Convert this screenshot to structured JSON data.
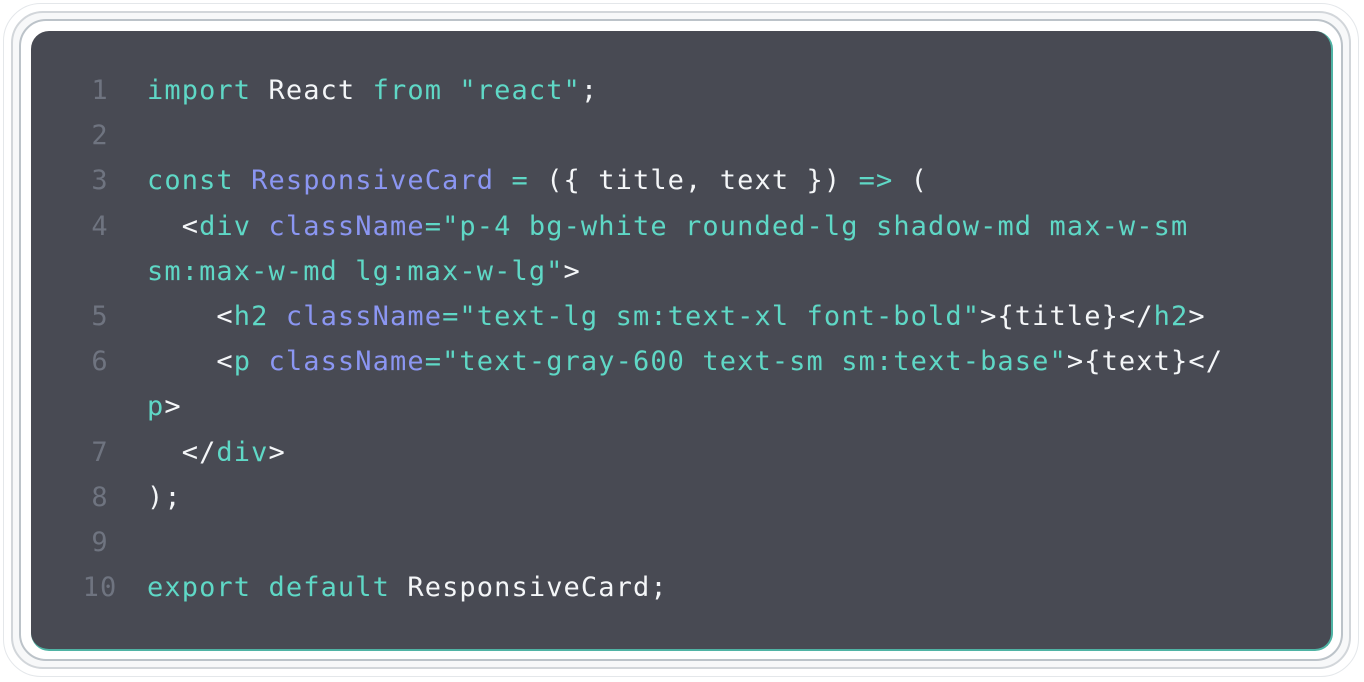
{
  "colors": {
    "panel_background": "#484a53",
    "keyword": "#5fd8c6",
    "string": "#5fd8c6",
    "identifier_accent": "#8b96f2",
    "text": "#f4f6f8",
    "line_number": "#6f7480",
    "panel_edge": "#4fb3a4"
  },
  "code": {
    "language": "jsx",
    "lines": [
      {
        "number": "1",
        "tokens": [
          {
            "text": "import",
            "type": "kw"
          },
          {
            "text": " React ",
            "type": "plain"
          },
          {
            "text": "from",
            "type": "kw"
          },
          {
            "text": " ",
            "type": "plain"
          },
          {
            "text": "\"react\"",
            "type": "str"
          },
          {
            "text": ";",
            "type": "punc"
          }
        ]
      },
      {
        "number": "2",
        "tokens": []
      },
      {
        "number": "3",
        "tokens": [
          {
            "text": "const",
            "type": "kw"
          },
          {
            "text": " ",
            "type": "plain"
          },
          {
            "text": "ResponsiveCard",
            "type": "fn"
          },
          {
            "text": " ",
            "type": "plain"
          },
          {
            "text": "=",
            "type": "op"
          },
          {
            "text": " ({ title, text }) ",
            "type": "plain"
          },
          {
            "text": "=>",
            "type": "op"
          },
          {
            "text": " (",
            "type": "plain"
          }
        ]
      },
      {
        "number": "4",
        "tokens": [
          {
            "text": "  <",
            "type": "plain"
          },
          {
            "text": "div",
            "type": "tag"
          },
          {
            "text": " ",
            "type": "plain"
          },
          {
            "text": "className",
            "type": "attr"
          },
          {
            "text": "=",
            "type": "op"
          },
          {
            "text": "\"p-4 bg-white rounded-lg shadow-md max-w-sm",
            "type": "str"
          }
        ]
      },
      {
        "number": "",
        "tokens": [
          {
            "text": "sm:max-w-md lg:max-w-lg\"",
            "type": "str"
          },
          {
            "text": ">",
            "type": "plain"
          }
        ]
      },
      {
        "number": "5",
        "tokens": [
          {
            "text": "    <",
            "type": "plain"
          },
          {
            "text": "h2",
            "type": "tag"
          },
          {
            "text": " ",
            "type": "plain"
          },
          {
            "text": "className",
            "type": "attr"
          },
          {
            "text": "=",
            "type": "op"
          },
          {
            "text": "\"text-lg sm:text-xl font-bold\"",
            "type": "str"
          },
          {
            "text": ">{title}</",
            "type": "plain"
          },
          {
            "text": "h2",
            "type": "tag"
          },
          {
            "text": ">",
            "type": "plain"
          }
        ]
      },
      {
        "number": "6",
        "tokens": [
          {
            "text": "    <",
            "type": "plain"
          },
          {
            "text": "p",
            "type": "tag"
          },
          {
            "text": " ",
            "type": "plain"
          },
          {
            "text": "className",
            "type": "attr"
          },
          {
            "text": "=",
            "type": "op"
          },
          {
            "text": "\"text-gray-600 text-sm sm:text-base\"",
            "type": "str"
          },
          {
            "text": ">{text}</",
            "type": "plain"
          }
        ]
      },
      {
        "number": "",
        "tokens": [
          {
            "text": "p",
            "type": "tag"
          },
          {
            "text": ">",
            "type": "plain"
          }
        ]
      },
      {
        "number": "7",
        "tokens": [
          {
            "text": "  </",
            "type": "plain"
          },
          {
            "text": "div",
            "type": "tag"
          },
          {
            "text": ">",
            "type": "plain"
          }
        ]
      },
      {
        "number": "8",
        "tokens": [
          {
            "text": ");",
            "type": "plain"
          }
        ]
      },
      {
        "number": "9",
        "tokens": []
      },
      {
        "number": "10",
        "tokens": [
          {
            "text": "export",
            "type": "kw"
          },
          {
            "text": " ",
            "type": "plain"
          },
          {
            "text": "default",
            "type": "kw"
          },
          {
            "text": " ResponsiveCard;",
            "type": "plain"
          }
        ]
      }
    ]
  }
}
